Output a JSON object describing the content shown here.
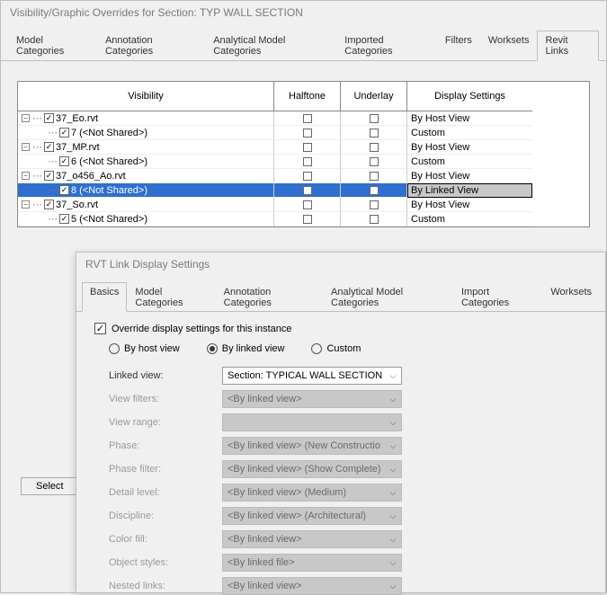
{
  "main": {
    "title": "Visibility/Graphic Overrides for Section: TYP WALL SECTION",
    "tabs": [
      "Model Categories",
      "Annotation Categories",
      "Analytical Model Categories",
      "Imported Categories",
      "Filters",
      "Worksets",
      "Revit Links"
    ],
    "active_tab": 6,
    "cols": {
      "vis": "Visibility",
      "ht": "Halftone",
      "ul": "Underlay",
      "ds": "Display Settings"
    },
    "rows": [
      {
        "level": 0,
        "expander": "-",
        "checked": true,
        "label": "37_Eo.rvt",
        "ds": "By Host View"
      },
      {
        "level": 1,
        "expander": "",
        "checked": true,
        "label": "7 (<Not Shared>)",
        "ds": "Custom"
      },
      {
        "level": 0,
        "expander": "-",
        "checked": true,
        "label": "37_MP.rvt",
        "ds": "By Host View"
      },
      {
        "level": 1,
        "expander": "",
        "checked": true,
        "label": "6 (<Not Shared>)",
        "ds": "Custom"
      },
      {
        "level": 0,
        "expander": "-",
        "checked": true,
        "label": "37_o456_Ao.rvt",
        "ds": "By Host View"
      },
      {
        "level": 1,
        "expander": "",
        "checked": true,
        "label": "8 (<Not Shared>)",
        "ds": "By Linked View",
        "selected": true
      },
      {
        "level": 0,
        "expander": "-",
        "checked": true,
        "label": "37_So.rvt",
        "ds": "By Host View"
      },
      {
        "level": 1,
        "expander": "",
        "checked": true,
        "label": "5 (<Not Shared>)",
        "ds": "Custom"
      }
    ],
    "select_btn": "Select"
  },
  "sub": {
    "title": "RVT Link Display Settings",
    "tabs": [
      "Basics",
      "Model Categories",
      "Annotation Categories",
      "Analytical Model Categories",
      "Import Categories",
      "Worksets"
    ],
    "active_tab": 0,
    "override_label": "Override display settings for this instance",
    "override_checked": true,
    "radios": {
      "host": "By host view",
      "linked": "By linked view",
      "custom": "Custom",
      "selected": "linked"
    },
    "fields": [
      {
        "label": "Linked view:",
        "value": "Section: TYPICAL WALL SECTION",
        "enabled": true
      },
      {
        "label": "View filters:",
        "value": "<By linked view>",
        "enabled": false
      },
      {
        "label": "View range:",
        "value": "",
        "enabled": false
      },
      {
        "label": "Phase:",
        "value": "<By linked view> (New Constructio",
        "enabled": false
      },
      {
        "label": "Phase filter:",
        "value": "<By linked view> (Show Complete)",
        "enabled": false
      },
      {
        "label": "Detail level:",
        "value": "<By linked view> (Medium)",
        "enabled": false
      },
      {
        "label": "Discipline:",
        "value": "<By linked view> (Architectural)",
        "enabled": false
      },
      {
        "label": "Color fill:",
        "value": "<By linked view>",
        "enabled": false
      },
      {
        "label": "Object styles:",
        "value": "<By linked file>",
        "enabled": false
      },
      {
        "label": "Nested links:",
        "value": "<By linked view>",
        "enabled": false
      }
    ]
  }
}
